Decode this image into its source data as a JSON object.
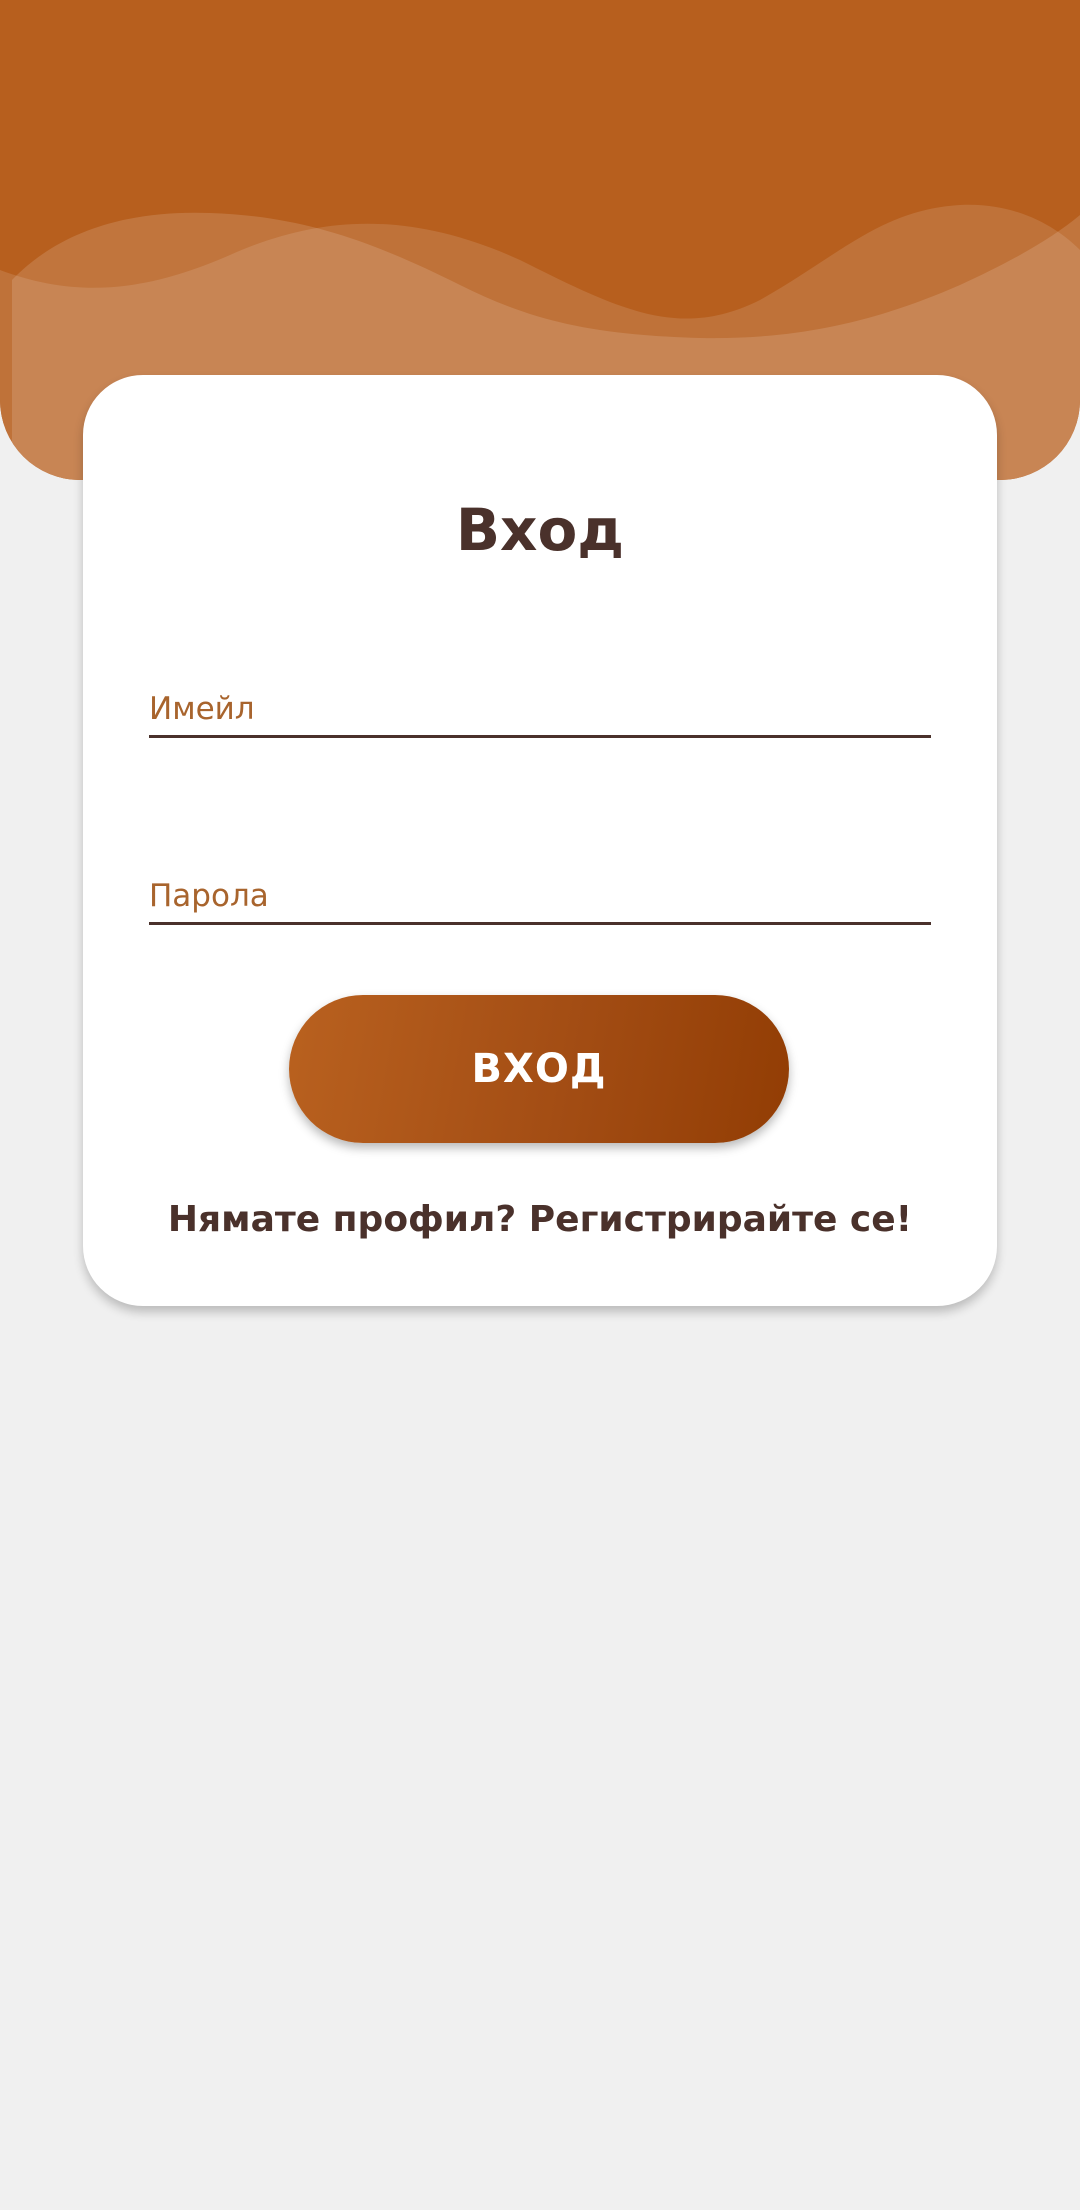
{
  "login": {
    "title": "Вход",
    "email_placeholder": "Имейл",
    "password_placeholder": "Парола",
    "login_button_label": "ВХОД",
    "register_link": "Нямате профил? Регистрирайте се!"
  },
  "colors": {
    "brand": "#b75f1e",
    "button_gradient_start": "#b9611f",
    "button_gradient_end": "#923d04",
    "text_dark": "#4a312b",
    "placeholder": "#a8642d",
    "background": "#f0f0f0"
  }
}
